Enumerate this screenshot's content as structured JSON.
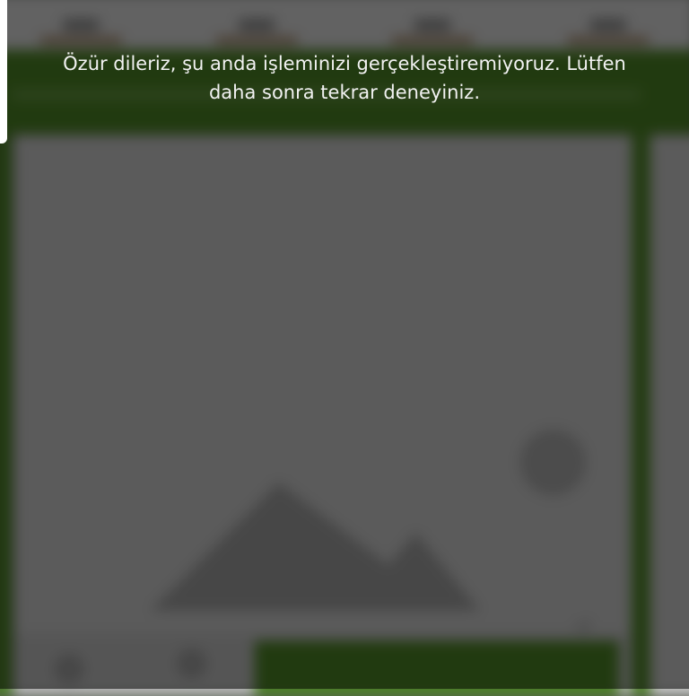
{
  "toast": {
    "message_line1": "Özür dileriz, şu anda işleminizi gerçekleştiremiyoruz. Lütfen",
    "message_line2": "daha sonra tekrar deneyiniz.",
    "icon": "status-circle-icon"
  },
  "background": {
    "accent_color": "#4b8224",
    "card_color": "#c9c9c9",
    "image_placeholder_icon": "image-placeholder-icon"
  },
  "colors": {
    "scrim": "rgba(0,0,0,0.55)",
    "text": "#f2f2f2"
  }
}
